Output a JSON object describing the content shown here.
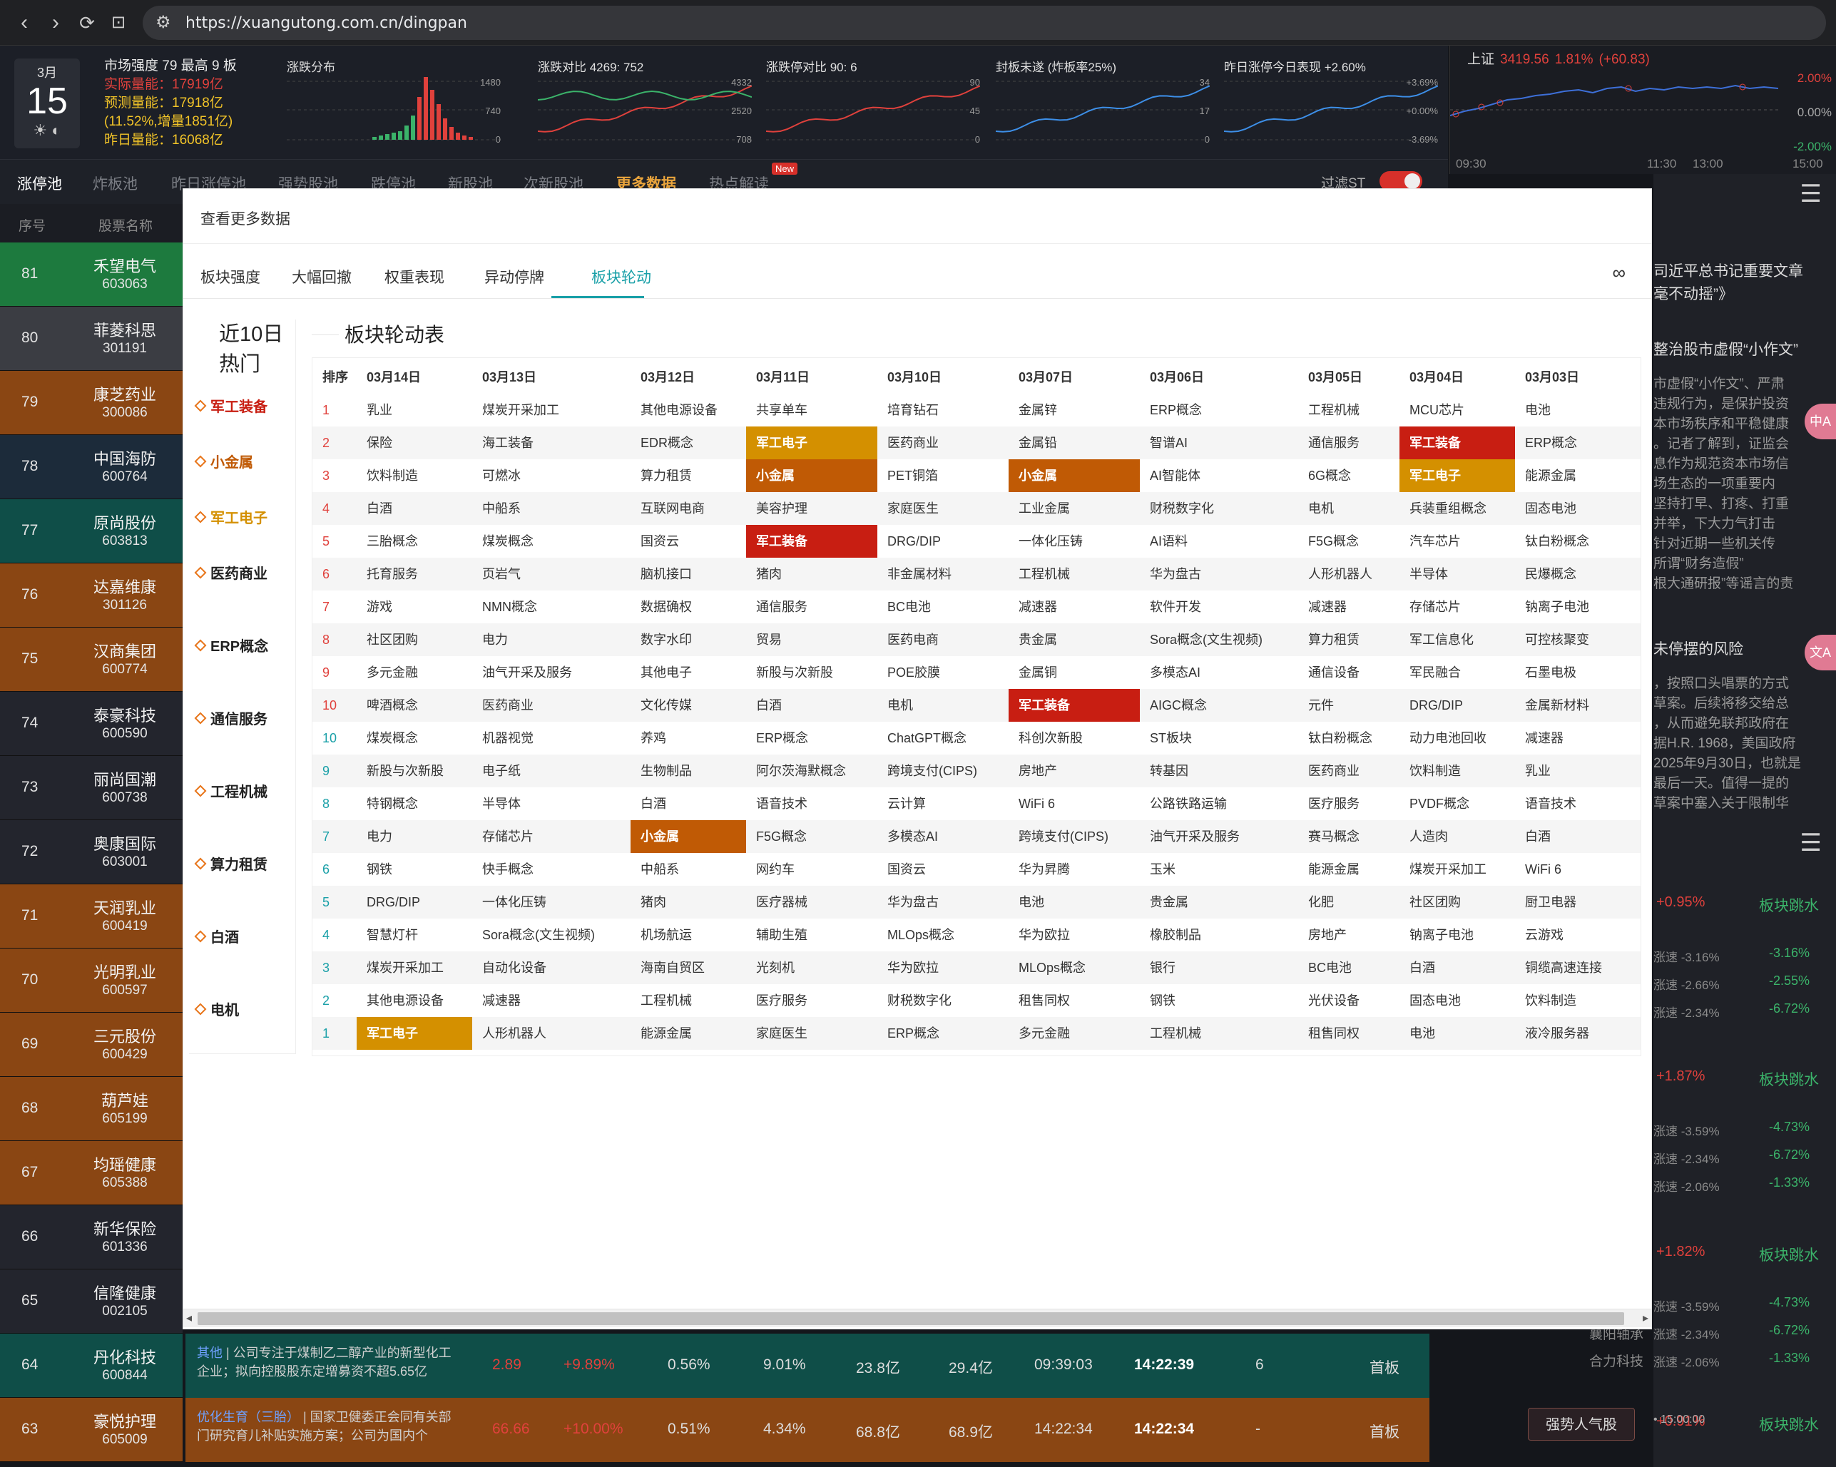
{
  "browser": {
    "url": "https://xuangutong.com.cn/dingpan",
    "back": "‹",
    "forward": "›",
    "reload": "⟳",
    "bookmark": "⊡"
  },
  "header": {
    "date_month": "3月",
    "date_day": "15",
    "strength": "市场强度 79 最高 9 板",
    "actual": "实际量能：17919亿",
    "predict": "预测量能：17918亿",
    "inc": "(11.52%,增量1851亿)",
    "yesterday": "昨日量能：16068亿",
    "minis": [
      {
        "title": "涨跌分布",
        "axes": [
          "1480",
          "740",
          "0"
        ]
      },
      {
        "title": "涨跌对比 4269: 752",
        "axes": [
          "4332",
          "2520",
          "708"
        ]
      },
      {
        "title": "涨跌停对比 90: 6",
        "axes": [
          "90",
          "45",
          "0"
        ]
      },
      {
        "title": "封板未遂 (炸板率25%)",
        "axes": [
          "34",
          "17",
          "0"
        ]
      },
      {
        "title": "昨日涨停今日表现 +2.60%",
        "axes": [
          "+3.69%",
          "+0.00%",
          "-3.69%"
        ]
      }
    ]
  },
  "index": {
    "name": "上证",
    "value": "3419.56",
    "pct": "1.81%",
    "chg": "(+60.83)",
    "y_top": "2.00%",
    "y_mid": "0.00%",
    "y_bot": "-2.00%",
    "times": [
      "09:30",
      "11:30",
      "13:00",
      "15:00"
    ],
    "colors": {
      "up": "#e0413c",
      "down": "#3bb36a"
    }
  },
  "tabs": [
    "涨停池",
    "炸板池",
    "昨日涨停池",
    "强势股池",
    "跌停池",
    "新股池",
    "次新股池",
    "更多数据",
    "热点解读"
  ],
  "tab_new": "New",
  "filter_label": "过滤ST",
  "col_headers": {
    "no": "序号",
    "name": "股票名称"
  },
  "left_rows": [
    {
      "no": "81",
      "name": "禾望电气",
      "code": "603063",
      "c": "green"
    },
    {
      "no": "80",
      "name": "菲菱科思",
      "code": "301191",
      "c": "gray"
    },
    {
      "no": "79",
      "name": "康芝药业",
      "code": "300086",
      "c": "orange"
    },
    {
      "no": "78",
      "name": "中国海防",
      "code": "600764",
      "c": "navy"
    },
    {
      "no": "77",
      "name": "原尚股份",
      "code": "603813",
      "c": "teal"
    },
    {
      "no": "76",
      "name": "达嘉维康",
      "code": "301126",
      "c": "orange"
    },
    {
      "no": "75",
      "name": "汉商集团",
      "code": "600774",
      "c": "orange"
    },
    {
      "no": "74",
      "name": "泰豪科技",
      "code": "600590",
      "c": "dark"
    },
    {
      "no": "73",
      "name": "丽尚国潮",
      "code": "600738",
      "c": "dark"
    },
    {
      "no": "72",
      "name": "奥康国际",
      "code": "603001",
      "c": "dark"
    },
    {
      "no": "71",
      "name": "天润乳业",
      "code": "600419",
      "c": "orange"
    },
    {
      "no": "70",
      "name": "光明乳业",
      "code": "600597",
      "c": "orange"
    },
    {
      "no": "69",
      "name": "三元股份",
      "code": "600429",
      "c": "orange"
    },
    {
      "no": "68",
      "name": "葫芦娃",
      "code": "605199",
      "c": "orange"
    },
    {
      "no": "67",
      "name": "均瑶健康",
      "code": "605388",
      "c": "orange"
    },
    {
      "no": "66",
      "name": "新华保险",
      "code": "601336",
      "c": "dark"
    },
    {
      "no": "65",
      "name": "信隆健康",
      "code": "002105",
      "c": "dark"
    },
    {
      "no": "64",
      "name": "丹化科技",
      "code": "600844",
      "c": "teal"
    },
    {
      "no": "63",
      "name": "豪悦护理",
      "code": "605009",
      "c": "orange"
    }
  ],
  "bottom_rows": [
    {
      "tag": "其他",
      "desc": " | 公司专注于煤制乙二醇产业的新型化工企业；拟向控股股东定增募资不超5.65亿",
      "price": "2.89",
      "pct": "+9.89%",
      "a": "0.56%",
      "b": "9.01%",
      "c": "23.8亿",
      "d": "29.4亿",
      "t1": "09:39:03",
      "t2": "14:22:39",
      "n": "6",
      "s": "首板"
    },
    {
      "tag": "优化生育（三胎）",
      "desc": " | 国家卫健委正会同有关部门研究育儿补贴实施方案；公司为国内个",
      "price": "66.66",
      "pct": "+10.00%",
      "a": "0.51%",
      "b": "4.34%",
      "c": "68.8亿",
      "d": "68.9亿",
      "t1": "14:22:34",
      "t2": "14:22:34",
      "n": "-",
      "s": "首板"
    }
  ],
  "right_panel": {
    "news": [
      "司近平总书记重要文章",
      "毫不动摇”》"
    ],
    "headline2": "整治股市虚假“小作文”",
    "body2": [
      "市虚假“小作文”、严肃",
      "违规行为，是保护投资",
      "本市场秩序和平稳健康",
      "。记者了解到，证监会",
      "息作为规范资本市场信",
      "场生态的一项重要内",
      "坚持打早、打疼、打重",
      "并举，下大力气打击",
      "针对近期一些机关传",
      "所谓“财务造假”",
      "根大通研报”等谣言的责"
    ],
    "headline3": "未停摆的风险",
    "body3": [
      "，按照口头唱票的方式",
      "草案。后续将移交给总",
      "，从而避免联邦政府在",
      "据H.R. 1968，美国政府",
      "2025年9月30日，也就是",
      "最后一天。值得一提的",
      "草案中塞入关于限制华"
    ],
    "sections": [
      {
        "pct": "+0.95%",
        "label": "板块跳水",
        "rows": [
          [
            "涨速 -3.16%",
            "-3.16%"
          ],
          [
            "涨速 -2.66%",
            "-2.55%"
          ],
          [
            "涨速 -2.34%",
            "-6.72%"
          ]
        ]
      },
      {
        "pct": "+1.87%",
        "label": "板块跳水",
        "rows": [
          [
            "涨速 -3.59%",
            "-4.73%"
          ],
          [
            "涨速 -2.34%",
            "-6.72%"
          ],
          [
            "涨速 -2.06%",
            "-1.33%"
          ]
        ]
      },
      {
        "pct": "+1.82%",
        "label": "板块跳水",
        "rows": [
          [
            "涨速 -3.59%",
            "-4.73%"
          ],
          [
            "涨速 -2.34%",
            "-6.72%"
          ],
          [
            "涨速 -2.06%",
            "-1.33%"
          ]
        ]
      }
    ],
    "partial_names": [
      "襄阳轴承",
      "合力科技"
    ],
    "bottom_time": "• 15:00:00",
    "bottom_btn": "强势人气股",
    "bottom_pct": "+0.91%",
    "bottom_label": "板块跳水",
    "fab1": "中A",
    "fab2": "文A"
  },
  "modal": {
    "title": "查看更多数据",
    "tabs": [
      "板块强度",
      "大幅回撤",
      "权重表现",
      "异动停牌",
      "板块轮动"
    ],
    "active_tab": "板块轮动",
    "infinity": "∞",
    "hot_title": "近10日热门",
    "hot_items": [
      "军工装备",
      "小金属",
      "军工电子",
      "医药商业",
      "ERP概念",
      "通信服务",
      "工程机械",
      "算力租赁",
      "白酒",
      "电机"
    ],
    "hot_colors": [
      "#c81e12",
      "#c05a05",
      "#d49000",
      "#222222",
      "#222222",
      "#222222",
      "#222222",
      "#222222",
      "#222222",
      "#222222"
    ],
    "table_title": "板块轮动表",
    "col_header": [
      "排序",
      "03月14日",
      "03月13日",
      "03月12日",
      "03月11日",
      "03月10日",
      "03月07日",
      "03月06日",
      "03月05日",
      "03月04日",
      "03月03日"
    ],
    "rows": [
      {
        "rank": "1",
        "cells": [
          "乳业",
          "煤炭开采加工",
          "其他电源设备",
          "共享单车",
          "培育钻石",
          "金属锌",
          "ERP概念",
          "工程机械",
          "MCU芯片",
          "电池"
        ]
      },
      {
        "rank": "2",
        "cells": [
          "保险",
          "海工装备",
          "EDR概念",
          "军工电子",
          "医药商业",
          "金属铅",
          "智谱AI",
          "通信服务",
          "军工装备",
          "ERP概念"
        ]
      },
      {
        "rank": "3",
        "cells": [
          "饮料制造",
          "可燃冰",
          "算力租赁",
          "小金属",
          "PET铜箔",
          "小金属",
          "AI智能体",
          "6G概念",
          "军工电子",
          "能源金属"
        ]
      },
      {
        "rank": "4",
        "cells": [
          "白酒",
          "中船系",
          "互联网电商",
          "美容护理",
          "家庭医生",
          "工业金属",
          "财税数字化",
          "电机",
          "兵装重组概念",
          "固态电池"
        ]
      },
      {
        "rank": "5",
        "cells": [
          "三胎概念",
          "煤炭概念",
          "国资云",
          "军工装备",
          "DRG/DIP",
          "一体化压铸",
          "AI语料",
          "F5G概念",
          "汽车芯片",
          "钛白粉概念"
        ]
      },
      {
        "rank": "6",
        "cells": [
          "托育服务",
          "页岩气",
          "脑机接口",
          "猪肉",
          "非金属材料",
          "工程机械",
          "华为盘古",
          "人形机器人",
          "半导体",
          "民爆概念"
        ]
      },
      {
        "rank": "7",
        "cells": [
          "游戏",
          "NMN概念",
          "数据确权",
          "通信服务",
          "BC电池",
          "减速器",
          "软件开发",
          "减速器",
          "存储芯片",
          "钠离子电池"
        ]
      },
      {
        "rank": "8",
        "cells": [
          "社区团购",
          "电力",
          "数字水印",
          "贸易",
          "医药电商",
          "贵金属",
          "Sora概念(文生视频)",
          "算力租赁",
          "军工信息化",
          "可控核聚变"
        ]
      },
      {
        "rank": "9",
        "cells": [
          "多元金融",
          "油气开采及服务",
          "其他电子",
          "新股与次新股",
          "POE胶膜",
          "金属铜",
          "多模态AI",
          "通信设备",
          "军民融合",
          "石墨电极"
        ]
      },
      {
        "rank": "10",
        "cells": [
          "啤酒概念",
          "医药商业",
          "文化传媒",
          "白酒",
          "电机",
          "军工装备",
          "AIGC概念",
          "元件",
          "DRG/DIP",
          "金属新材料"
        ]
      },
      {
        "rank": "10",
        "cells": [
          "煤炭概念",
          "机器视觉",
          "养鸡",
          "ERP概念",
          "ChatGPT概念",
          "科创次新股",
          "ST板块",
          "钛白粉概念",
          "动力电池回收",
          "减速器"
        ]
      },
      {
        "rank": "9",
        "cells": [
          "新股与次新股",
          "电子纸",
          "生物制品",
          "阿尔茨海默概念",
          "跨境支付(CIPS)",
          "房地产",
          "转基因",
          "医药商业",
          "饮料制造",
          "乳业"
        ]
      },
      {
        "rank": "8",
        "cells": [
          "特钢概念",
          "半导体",
          "白酒",
          "语音技术",
          "云计算",
          "WiFi 6",
          "公路铁路运输",
          "医疗服务",
          "PVDF概念",
          "语音技术"
        ]
      },
      {
        "rank": "7",
        "cells": [
          "电力",
          "存储芯片",
          "小金属",
          "F5G概念",
          "多模态AI",
          "跨境支付(CIPS)",
          "油气开采及服务",
          "赛马概念",
          "人造肉",
          "白酒"
        ]
      },
      {
        "rank": "6",
        "cells": [
          "钢铁",
          "快手概念",
          "中船系",
          "网约车",
          "国资云",
          "华为昇腾",
          "玉米",
          "能源金属",
          "煤炭开采加工",
          "WiFi 6"
        ]
      },
      {
        "rank": "5",
        "cells": [
          "DRG/DIP",
          "一体化压铸",
          "猪肉",
          "医疗器械",
          "华为盘古",
          "电池",
          "贵金属",
          "化肥",
          "社区团购",
          "厨卫电器"
        ]
      },
      {
        "rank": "4",
        "cells": [
          "智慧灯杆",
          "Sora概念(文生视频)",
          "机场航运",
          "辅助生殖",
          "MLOps概念",
          "华为欧拉",
          "橡胶制品",
          "房地产",
          "钠离子电池",
          "云游戏"
        ]
      },
      {
        "rank": "3",
        "cells": [
          "煤炭开采加工",
          "自动化设备",
          "海南自贸区",
          "光刻机",
          "华为欧拉",
          "MLOps概念",
          "银行",
          "BC电池",
          "白酒",
          "铜缆高速连接"
        ]
      },
      {
        "rank": "2",
        "cells": [
          "其他电源设备",
          "减速器",
          "工程机械",
          "医疗服务",
          "财税数字化",
          "租售同权",
          "钢铁",
          "光伏设备",
          "固态电池",
          "饮料制造"
        ]
      },
      {
        "rank": "1",
        "cells": [
          "军工电子",
          "人形机器人",
          "能源金属",
          "家庭医生",
          "ERP概念",
          "多元金融",
          "工程机械",
          "租售同权",
          "电池",
          "液冷服务器"
        ]
      }
    ],
    "highlight_colors": {
      "军工装备": "#c81e12",
      "小金属": "#c05a05",
      "军工电子": "#d49000"
    },
    "rank_colors": {
      "top": "#e0413c",
      "bottom": "#1aa0a8"
    }
  }
}
